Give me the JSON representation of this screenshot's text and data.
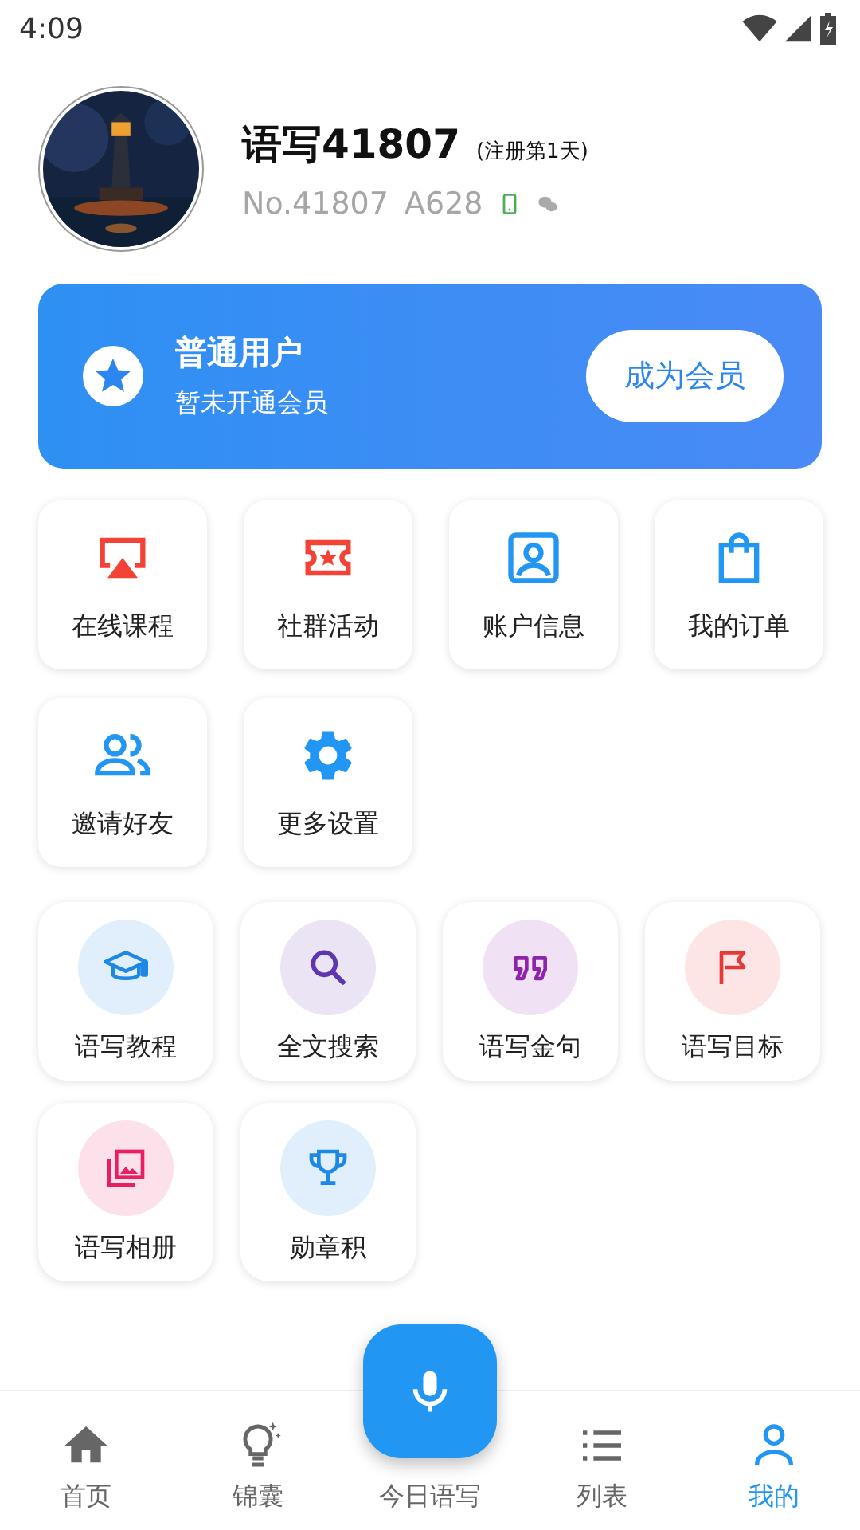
{
  "status_bar": {
    "time": "4:09"
  },
  "profile": {
    "name": "语写41807",
    "registered": "(注册第1天)",
    "number": "No.41807",
    "code": "A628",
    "bindings": [
      {
        "kind": "phone",
        "bound": true
      },
      {
        "kind": "wechat",
        "bound": false
      }
    ]
  },
  "membership": {
    "title": "普通用户",
    "subtitle": "暂未开通会员",
    "button": "成为会员"
  },
  "shortcuts": [
    {
      "label": "在线课程",
      "color": "#f44336"
    },
    {
      "label": "社群活动",
      "color": "#f44336"
    },
    {
      "label": "账户信息",
      "color": "#2196f3"
    },
    {
      "label": "我的订单",
      "color": "#2196f3"
    },
    {
      "label": "邀请好友",
      "color": "#2196f3"
    },
    {
      "label": "更多设置",
      "color": "#2196f3"
    }
  ],
  "tools": [
    {
      "label": "语写教程",
      "color": "#1e88e5"
    },
    {
      "label": "全文搜索",
      "color": "#5e35b1"
    },
    {
      "label": "语写金句",
      "color": "#8e24aa"
    },
    {
      "label": "语写目标",
      "color": "#e53935"
    },
    {
      "label": "语写相册",
      "color": "#e91e63"
    },
    {
      "label": "勋章积",
      "color": "#1e88e5"
    }
  ],
  "nav": {
    "items": [
      {
        "label": "首页",
        "selected": false
      },
      {
        "label": "锦囊",
        "selected": false
      },
      {
        "label": "今日语写",
        "selected": false
      },
      {
        "label": "列表",
        "selected": false
      },
      {
        "label": "我的",
        "selected": true
      }
    ]
  }
}
